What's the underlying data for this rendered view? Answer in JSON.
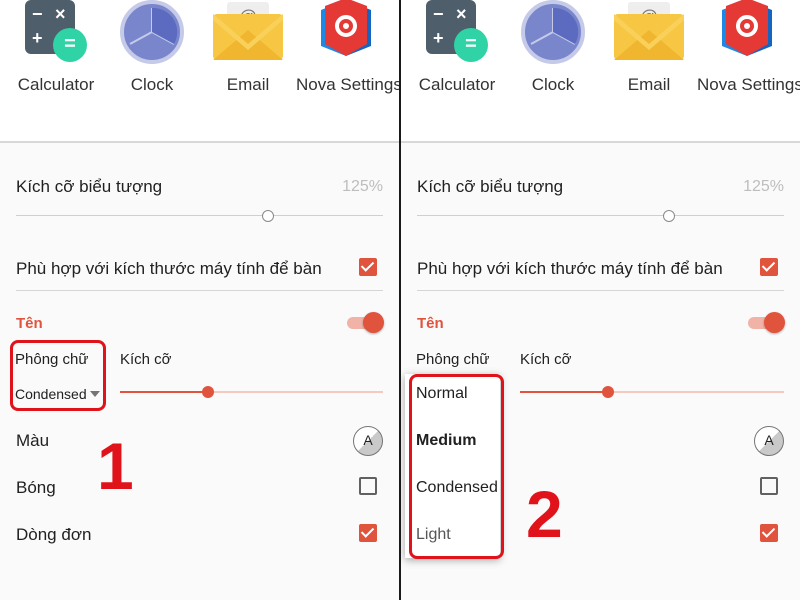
{
  "apps": [
    {
      "label": "Calculator",
      "icon": "calculator-icon"
    },
    {
      "label": "Clock",
      "icon": "clock-icon"
    },
    {
      "label": "Email",
      "icon": "email-icon"
    },
    {
      "label": "Nova Settings",
      "icon": "nova-settings-icon"
    }
  ],
  "calc_glyphs": {
    "minus": "−",
    "times": "×",
    "plus": "+",
    "equals": "="
  },
  "email_glyph": "@",
  "settings": {
    "icon_size": {
      "label": "Kích cỡ biểu tượng",
      "value": "125%"
    },
    "fit_desktop": {
      "label": "Phù hợp với kích thước máy tính để bàn",
      "checked": true
    },
    "name_section": {
      "title": "Tên",
      "enabled": true
    },
    "font": {
      "label": "Phông chữ",
      "value": "Condensed"
    },
    "size": {
      "label": "Kích cỡ",
      "level": 0.27
    },
    "color": {
      "label": "Màu",
      "chip_text": "A"
    },
    "shadow": {
      "label": "Bóng",
      "checked": false
    },
    "single_line": {
      "label": "Dòng đơn",
      "checked": true
    }
  },
  "font_options": [
    "Normal",
    "Medium",
    "Condensed",
    "Light"
  ],
  "annotations": {
    "step1": "1",
    "step2": "2"
  },
  "colors": {
    "accent": "#e0533c",
    "annotation": "#e0131b"
  }
}
